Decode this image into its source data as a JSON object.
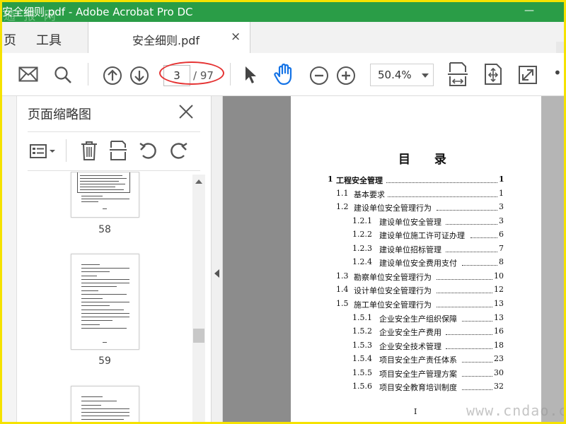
{
  "window": {
    "title": "安全细则.pdf - Adobe Acrobat Pro DC",
    "watermark_top": "通 报 网",
    "minimize_glyph": "—"
  },
  "tabs": {
    "nav_home": "页",
    "nav_tools": "工具",
    "doc_tab_label": "安全细则.pdf",
    "close_glyph": "×"
  },
  "toolbar": {
    "current_page": "3",
    "total_pages": "/ 97",
    "zoom": "50.4%",
    "more_glyph": "•••",
    "icons": [
      "mail-icon",
      "search-icon",
      "page-up-icon",
      "page-down-icon",
      "select-arrow-icon",
      "hand-icon",
      "zoom-out-icon",
      "zoom-in-icon",
      "fit-width-icon",
      "fit-page-icon",
      "fullscreen-icon"
    ]
  },
  "panel": {
    "title": "页面缩略图",
    "close_glyph": "×",
    "icons": [
      "thumbnail-options-icon",
      "trash-icon",
      "extract-icon",
      "rotate-left-icon",
      "rotate-right-icon"
    ],
    "thumbnails": [
      {
        "label": "58"
      },
      {
        "label": "59"
      },
      {
        "label": ""
      }
    ]
  },
  "document": {
    "toc_title": "目 录",
    "footer": "I",
    "entries": [
      {
        "num": "1",
        "text": "工程安全管理",
        "page": "1",
        "level": 0
      },
      {
        "num": "1.1",
        "text": "基本要求",
        "page": "1",
        "level": 1
      },
      {
        "num": "1.2",
        "text": "建设单位安全管理行为",
        "page": "3",
        "level": 1
      },
      {
        "num": "1.2.1",
        "text": "建设单位安全管理",
        "page": "3",
        "level": 2
      },
      {
        "num": "1.2.2",
        "text": "建设单位施工许可证办理",
        "page": "6",
        "level": 2
      },
      {
        "num": "1.2.3",
        "text": "建设单位招标管理",
        "page": "7",
        "level": 2
      },
      {
        "num": "1.2.4",
        "text": "建设单位安全费用支付",
        "page": "8",
        "level": 2
      },
      {
        "num": "1.3",
        "text": "勘察单位安全管理行为",
        "page": "10",
        "level": 1
      },
      {
        "num": "1.4",
        "text": "设计单位安全管理行为",
        "page": "12",
        "level": 1
      },
      {
        "num": "1.5",
        "text": "施工单位安全管理行为",
        "page": "13",
        "level": 1
      },
      {
        "num": "1.5.1",
        "text": "企业安全生产组织保障",
        "page": "13",
        "level": 2
      },
      {
        "num": "1.5.2",
        "text": "企业安全生产费用",
        "page": "16",
        "level": 2
      },
      {
        "num": "1.5.3",
        "text": "企业安全技术管理",
        "page": "18",
        "level": 2
      },
      {
        "num": "1.5.4",
        "text": "项目安全生产责任体系",
        "page": "23",
        "level": 2
      },
      {
        "num": "1.5.5",
        "text": "项目安全生产管理方案",
        "page": "30",
        "level": 2
      },
      {
        "num": "1.5.6",
        "text": "项目安全教育培训制度",
        "page": "32",
        "level": 2
      }
    ],
    "watermark": "www.cndao.c"
  },
  "colors": {
    "titlebar": "#2a9d47",
    "frame": "#f5e200",
    "highlight": "#e53333",
    "hand_tool": "#1473e6"
  }
}
